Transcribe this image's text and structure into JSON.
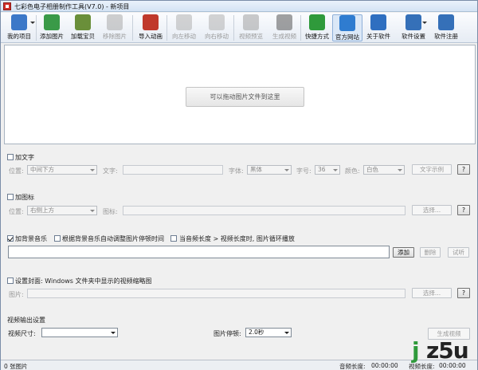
{
  "window": {
    "title": "七彩色电子相册制作工具(V7.0) - 新项目"
  },
  "toolbar": [
    {
      "key": "my-project",
      "label": "我的项目",
      "icon": "folder-icon",
      "color": "#3c78c8",
      "enabled": true,
      "dropdown": true
    },
    {
      "key": "add-image",
      "label": "添加图片",
      "icon": "add-image-icon",
      "color": "#3a9a48",
      "enabled": true
    },
    {
      "key": "load-baby",
      "label": "加载宝贝",
      "icon": "load-baby-icon",
      "color": "#6a8f3a",
      "enabled": true
    },
    {
      "key": "remove-image",
      "label": "移除图片",
      "icon": "remove-image-icon",
      "color": "#a9a9a9",
      "enabled": false
    },
    {
      "key": "import-animation",
      "label": "导入动画",
      "icon": "import-animation-icon",
      "color": "#c0392b",
      "enabled": true
    },
    {
      "key": "move-left",
      "label": "向左移动",
      "icon": "arrow-left-icon",
      "color": "#b0b0b0",
      "enabled": false
    },
    {
      "key": "move-right",
      "label": "向右移动",
      "icon": "arrow-right-icon",
      "color": "#b0b0b0",
      "enabled": false
    },
    {
      "key": "video-preview",
      "label": "视频预览",
      "icon": "magnifier-icon",
      "color": "#a0a0a0",
      "enabled": false
    },
    {
      "key": "generate-video",
      "label": "生成视频",
      "icon": "film-icon",
      "color": "#555555",
      "enabled": false
    },
    {
      "key": "shortcut",
      "label": "快捷方式",
      "icon": "blocks-icon",
      "color": "#2f9a3b",
      "enabled": true
    },
    {
      "key": "official-site",
      "label": "官方网站",
      "icon": "ie-icon",
      "color": "#2f7cd0",
      "enabled": true,
      "selected": true
    },
    {
      "key": "about",
      "label": "关于软件",
      "icon": "info-icon",
      "color": "#2f6fc0",
      "enabled": true
    },
    {
      "key": "settings",
      "label": "软件设置",
      "icon": "gear-icon",
      "color": "#3570b8",
      "enabled": true,
      "dropdown": true
    },
    {
      "key": "register",
      "label": "软件注册",
      "icon": "monitor-icon",
      "color": "#3570b8",
      "enabled": true
    }
  ],
  "canvas": {
    "drop_hint": "可以拖动图片文件到这里"
  },
  "text_section": {
    "checkbox_label": "加文字",
    "position_label": "位置:",
    "position_value": "中间下方",
    "text_label": "文字:",
    "font_label": "字体:",
    "font_value": "黑体",
    "size_label": "字号:",
    "size_value": "36",
    "color_label": "颜色:",
    "color_value": "白色",
    "sample_button": "文字示例",
    "help_button": "?"
  },
  "icon_section": {
    "checkbox_label": "加图标",
    "position_label": "位置:",
    "position_value": "右侧上方",
    "icon_label": "图标:",
    "select_button": "选择...",
    "help_button": "?"
  },
  "music_section": {
    "bg_music_label": "加背景音乐",
    "auto_adjust_label": "根据背景音乐自动调整图片停顿时间",
    "loop_label": "当音频长度 > 视频长度时, 图片循环播放",
    "add_button": "添加",
    "delete_button": "删除",
    "listen_button": "试听"
  },
  "cover_section": {
    "checkbox_label": "设置封面: Windows 文件夹中显示的视频缩略图",
    "image_label": "图片:",
    "select_button": "选择...",
    "help_button": "?"
  },
  "output_section": {
    "heading": "视频输出设置",
    "size_label": "视频尺寸:",
    "size_value": "",
    "pause_label": "图片停顿:",
    "pause_value": "2.0秒",
    "generate_button": "生成视频"
  },
  "status": {
    "image_count": "0 张图片",
    "audio_length_label": "音频长度:",
    "audio_length": "00:00:00",
    "video_length_label": "视频长度:",
    "video_length": "00:00:00"
  },
  "watermark": {
    "j": "j",
    "rest": "z5u"
  }
}
